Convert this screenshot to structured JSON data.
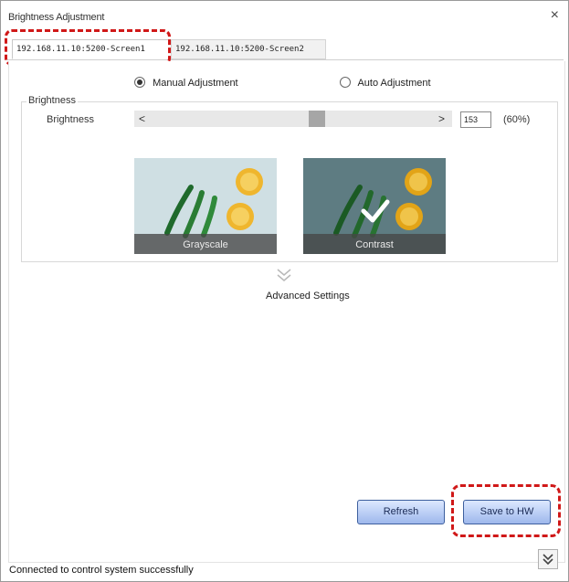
{
  "window": {
    "title": "Brightness Adjustment",
    "close_glyph": "×"
  },
  "tabs": [
    {
      "label": "192.168.11.10:5200-Screen1"
    },
    {
      "label": "192.168.11.10:5200-Screen2"
    }
  ],
  "mode": {
    "manual_label": "Manual Adjustment",
    "auto_label": "Auto Adjustment",
    "selected": "manual"
  },
  "brightness": {
    "group_label": "Brightness",
    "row_label": "Brightness",
    "left_arrow": "<",
    "right_arrow": ">",
    "value": "153",
    "percent": "(60%)",
    "slider_fraction": 0.6
  },
  "presets": [
    {
      "label": "Grayscale",
      "selected": false
    },
    {
      "label": "Contrast",
      "selected": true
    }
  ],
  "advanced": {
    "label": "Advanced Settings",
    "icon": "double-chevron-down-icon"
  },
  "buttons": {
    "refresh": "Refresh",
    "save": "Save to HW"
  },
  "status": {
    "text": "Connected to control system successfully"
  },
  "colors": {
    "highlight": "#d01818",
    "button_border": "#3d5f9e"
  }
}
